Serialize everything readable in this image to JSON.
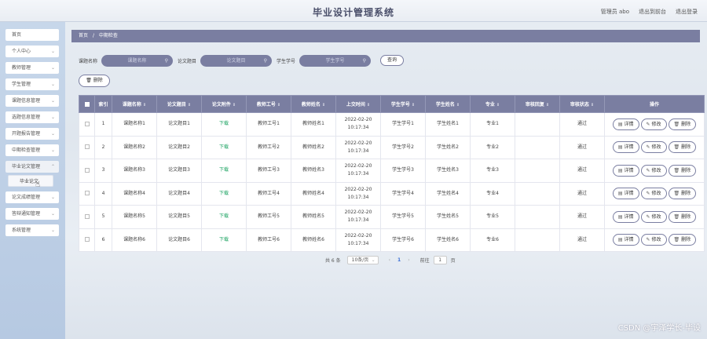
{
  "header": {
    "title": "毕业设计管理系统",
    "admin": "管理员 abo",
    "back_front": "退出到前台",
    "logout": "退出登录"
  },
  "sidebar": {
    "items": [
      {
        "label": "首页",
        "chevron": false
      },
      {
        "label": "个人中心",
        "chevron": true
      },
      {
        "label": "教师管理",
        "chevron": true
      },
      {
        "label": "学生管理",
        "chevron": true
      },
      {
        "label": "课题信息管理",
        "chevron": true
      },
      {
        "label": "选题信息管理",
        "chevron": true
      },
      {
        "label": "开题报告管理",
        "chevron": true
      },
      {
        "label": "中期检查管理",
        "chevron": true
      },
      {
        "label": "毕业论文管理",
        "chevron": true
      },
      {
        "label": "论文成绩管理",
        "chevron": true
      },
      {
        "label": "答辩通知管理",
        "chevron": true
      },
      {
        "label": "系统管理",
        "chevron": true
      }
    ],
    "submenu": {
      "label": "毕业论文"
    }
  },
  "breadcrumb": {
    "home": "首页",
    "sep": "/",
    "current": "中期检查"
  },
  "search": {
    "fields": [
      {
        "label": "课题名称",
        "placeholder": "课题名称"
      },
      {
        "label": "论文题目",
        "placeholder": "论文题目"
      },
      {
        "label": "学生学号",
        "placeholder": "学生学号"
      }
    ],
    "query_label": "查询"
  },
  "toolbar": {
    "delete_label": "删除"
  },
  "table": {
    "headers": [
      "索引",
      "课题名称",
      "论文题目",
      "论文附件",
      "教师工号",
      "教师姓名",
      "上交时间",
      "学生学号",
      "学生姓名",
      "专业",
      "审核回复",
      "审核状态",
      "操作"
    ],
    "rows": [
      {
        "idx": "1",
        "topic": "课题名称1",
        "paper": "论文题目1",
        "attach": "下载",
        "tno": "教师工号1",
        "tname": "教师姓名1",
        "time": "2022-02-20 10:17:34",
        "sno": "学生学号1",
        "sname": "学生姓名1",
        "major": "专业1",
        "reply": "",
        "status": "通过"
      },
      {
        "idx": "2",
        "topic": "课题名称2",
        "paper": "论文题目2",
        "attach": "下载",
        "tno": "教师工号2",
        "tname": "教师姓名2",
        "time": "2022-02-20 10:17:34",
        "sno": "学生学号2",
        "sname": "学生姓名2",
        "major": "专业2",
        "reply": "",
        "status": "通过"
      },
      {
        "idx": "3",
        "topic": "课题名称3",
        "paper": "论文题目3",
        "attach": "下载",
        "tno": "教师工号3",
        "tname": "教师姓名3",
        "time": "2022-02-20 10:17:34",
        "sno": "学生学号3",
        "sname": "学生姓名3",
        "major": "专业3",
        "reply": "",
        "status": "通过"
      },
      {
        "idx": "4",
        "topic": "课题名称4",
        "paper": "论文题目4",
        "attach": "下载",
        "tno": "教师工号4",
        "tname": "教师姓名4",
        "time": "2022-02-20 10:17:34",
        "sno": "学生学号4",
        "sname": "学生姓名4",
        "major": "专业4",
        "reply": "",
        "status": "通过"
      },
      {
        "idx": "5",
        "topic": "课题名称5",
        "paper": "论文题目5",
        "attach": "下载",
        "tno": "教师工号5",
        "tname": "教师姓名5",
        "time": "2022-02-20 10:17:34",
        "sno": "学生学号5",
        "sname": "学生姓名5",
        "major": "专业5",
        "reply": "",
        "status": "通过"
      },
      {
        "idx": "6",
        "topic": "课题名称6",
        "paper": "论文题目6",
        "attach": "下载",
        "tno": "教师工号6",
        "tname": "教师姓名6",
        "time": "2022-02-20 10:17:34",
        "sno": "学生学号6",
        "sname": "学生姓名6",
        "major": "专业6",
        "reply": "",
        "status": "通过"
      }
    ],
    "ops": {
      "detail": "详情",
      "edit": "修改",
      "delete": "删除"
    }
  },
  "pagination": {
    "total": "共 6 条",
    "page_size": "10条/页",
    "current_page": "1",
    "goto_label": "前往",
    "goto_value": "1",
    "page_unit": "页"
  },
  "watermark": "CSDN @宇泽学长-毕设",
  "colors": {
    "accent": "#7a7ea1",
    "download": "#1aa260",
    "sidebar": "#c7d7ea"
  }
}
